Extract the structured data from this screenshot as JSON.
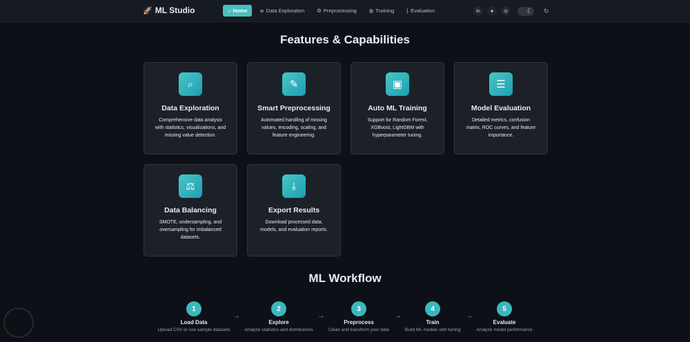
{
  "nav": {
    "brand": "ML Studio",
    "brand_icon": "rocket-icon",
    "links": [
      {
        "label": "Home",
        "icon": "home-icon",
        "active": true
      },
      {
        "label": "Data Exploration",
        "icon": "database-icon"
      },
      {
        "label": "Preprocessing",
        "icon": "cogs-icon"
      },
      {
        "label": "Training",
        "icon": "brain-icon"
      },
      {
        "label": "Evaluation",
        "icon": "chart-line-icon"
      }
    ],
    "social": [
      "linkedin-icon",
      "github-icon",
      "instagram-icon"
    ],
    "theme": "dark"
  },
  "features": {
    "title": "Features & Capabilities",
    "cards": [
      {
        "title": "Data Exploration",
        "icon": "search-icon",
        "desc": "Comprehensive data analysis with statistics, visualizations, and missing value detection."
      },
      {
        "title": "Smart Preprocessing",
        "icon": "pencil-icon",
        "desc": "Automated handling of missing values, encoding, scaling, and feature engineering."
      },
      {
        "title": "Auto ML Training",
        "icon": "robot-icon",
        "desc": "Support for Random Forest, XGBoost, LightGBM with hyperparameter tuning."
      },
      {
        "title": "Model Evaluation",
        "icon": "chart-icon",
        "desc": "Detailed metrics, confusion matrix, ROC curves, and feature importance."
      },
      {
        "title": "Data Balancing",
        "icon": "balance-scale-icon",
        "desc": "SMOTE, undersampling, and oversampling for imbalanced datasets."
      },
      {
        "title": "Export Results",
        "icon": "download-icon",
        "desc": "Download processed data, models, and evaluation reports."
      }
    ]
  },
  "workflow": {
    "title": "ML Workflow",
    "steps": [
      {
        "num": "1",
        "label": "Load Data",
        "desc": "Upload CSV or use sample datasets"
      },
      {
        "num": "2",
        "label": "Explore",
        "desc": "Analyze statistics and distributions"
      },
      {
        "num": "3",
        "label": "Preprocess",
        "desc": "Clean and transform your data"
      },
      {
        "num": "4",
        "label": "Train",
        "desc": "Build ML models with tuning"
      },
      {
        "num": "5",
        "label": "Evaluate",
        "desc": "Analyze model performance"
      }
    ]
  },
  "colors": {
    "accent": "#3bb8bd",
    "background": "#0d1117",
    "card": "#1c2128"
  }
}
